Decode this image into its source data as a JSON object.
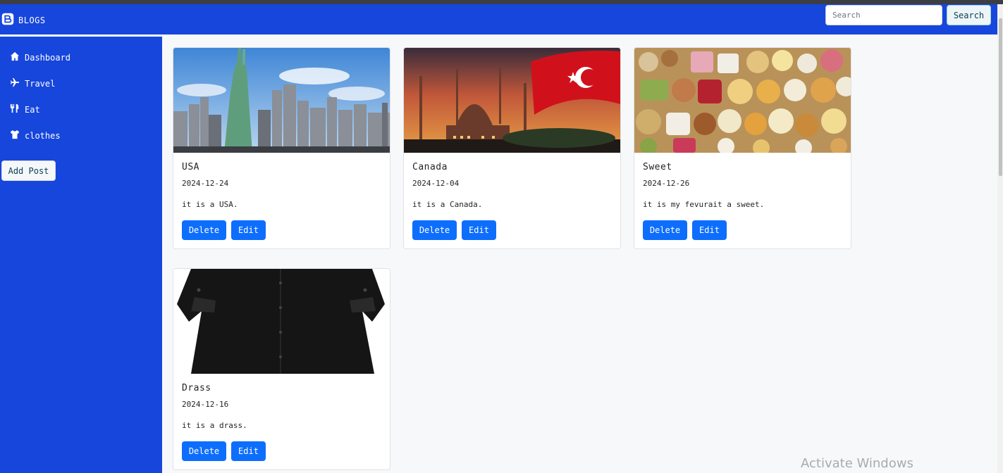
{
  "navbar": {
    "brand_label": "BLOGS",
    "brand_icon": "blogger-icon",
    "search_placeholder": "Search",
    "search_button_label": "Search"
  },
  "sidebar": {
    "items": [
      {
        "label": "Dashboard",
        "icon": "home-icon"
      },
      {
        "label": "Travel",
        "icon": "plane-icon"
      },
      {
        "label": "Eat",
        "icon": "utensils-icon"
      },
      {
        "label": "clothes",
        "icon": "shirt-icon"
      }
    ],
    "add_post_label": "Add Post"
  },
  "posts": [
    {
      "title": "USA",
      "date": "2024-12-24",
      "description": "it is a USA.",
      "image": "new-york-statue-of-liberty-skyline",
      "delete_label": "Delete",
      "edit_label": "Edit"
    },
    {
      "title": "Canada",
      "date": "2024-12-04",
      "description": "it is a Canada.",
      "image": "istanbul-mosque-turkish-flag-sunset",
      "delete_label": "Delete",
      "edit_label": "Edit"
    },
    {
      "title": "Sweet",
      "date": "2024-12-26",
      "description": "it is my fevurait a sweet.",
      "image": "turkish-delight-sweets",
      "delete_label": "Delete",
      "edit_label": "Edit"
    },
    {
      "title": "Drass",
      "date": "2024-12-16",
      "description": "it is a drass.",
      "image": "black-dress",
      "delete_label": "Delete",
      "edit_label": "Edit"
    }
  ],
  "watermark": "Activate Windows",
  "colors": {
    "primary": "#1746dc",
    "button": "#0d6efd",
    "background": "#f7f8f9"
  }
}
